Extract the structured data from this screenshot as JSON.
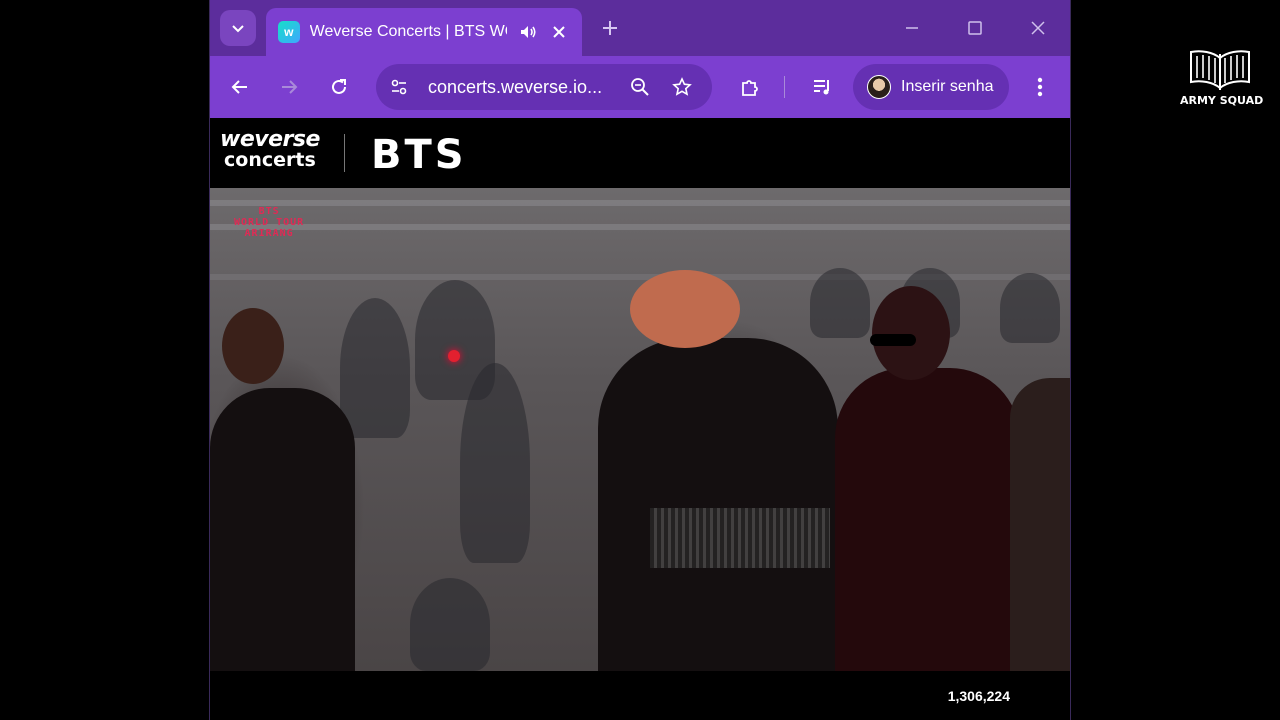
{
  "browser": {
    "tab": {
      "title": "Weverse Concerts | BTS WO",
      "favicon_letter": "w"
    },
    "toolbar": {
      "url": "concerts.weverse.io...",
      "profile_label": "Inserir senha"
    },
    "colors": {
      "frame": "#5c2d9c",
      "toolbar": "#7c3fd0"
    }
  },
  "page": {
    "header": {
      "brand_line1": "weverse",
      "brand_line2": "concerts",
      "artist": "BTS"
    },
    "video": {
      "overlay_logo_lines": [
        "BTS",
        "WORLD TOUR",
        "ARIRANG"
      ]
    },
    "viewer_count": "1,306,224"
  },
  "watermark": {
    "text": "ARMY SQUAD"
  }
}
